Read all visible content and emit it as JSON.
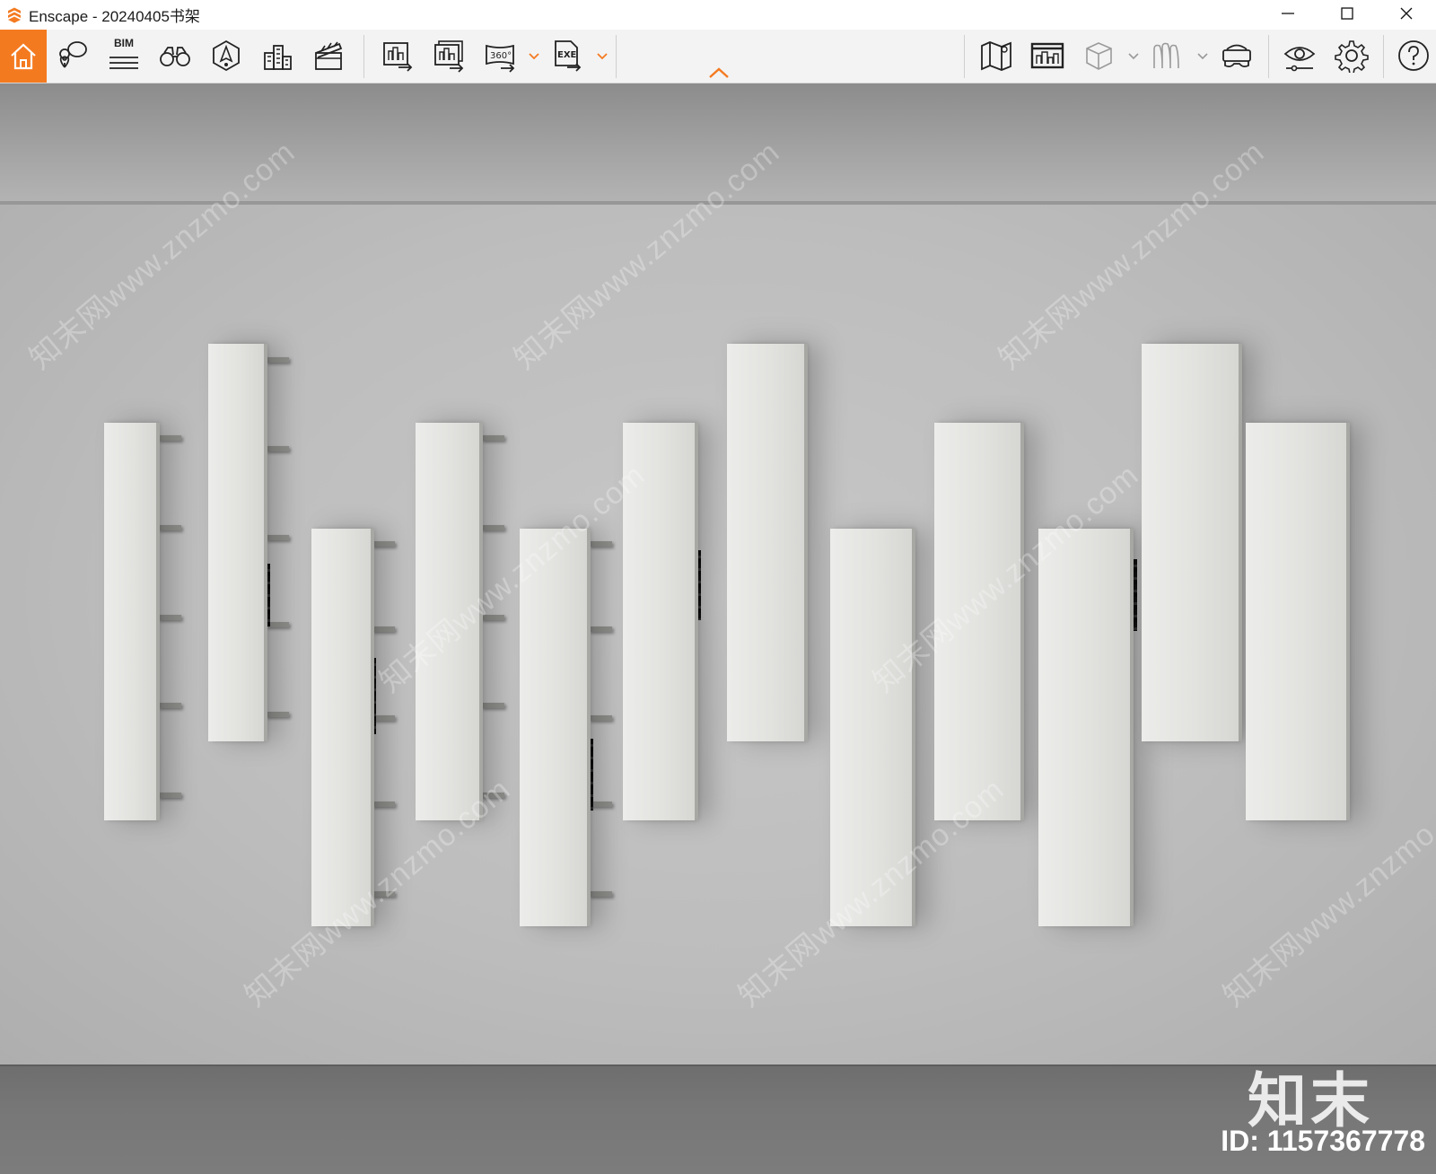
{
  "window": {
    "title": "Enscape - 20240405书架",
    "icons": [
      "enscape-logo-icon",
      "minimize-icon",
      "maximize-icon",
      "close-icon"
    ]
  },
  "toolbar": {
    "bim_label": "BIM",
    "accent": "#f47a20",
    "left_tools": [
      "home-icon",
      "location-pin-icon",
      "bim-info-icon",
      "binoculars-icon",
      "navigation-icon",
      "building-icon",
      "clapper-board-icon"
    ],
    "export_tools": [
      "render-image-icon",
      "batch-render-icon",
      "panorama-360-icon",
      "export-exe-icon"
    ],
    "right_tools": [
      "map-icon",
      "asset-library-icon",
      "cube-view-icon",
      "material-icon",
      "vr-headset-icon",
      "visual-settings-icon",
      "settings-icon",
      "help-icon"
    ],
    "collapse_icon": "chevron-up-icon"
  },
  "viewport": {
    "scene": "wall-mounted bookshelf panels",
    "watermark_text": "知末网www.znzmo.com",
    "brand": "知末",
    "id_label": "ID: 1157367778"
  }
}
